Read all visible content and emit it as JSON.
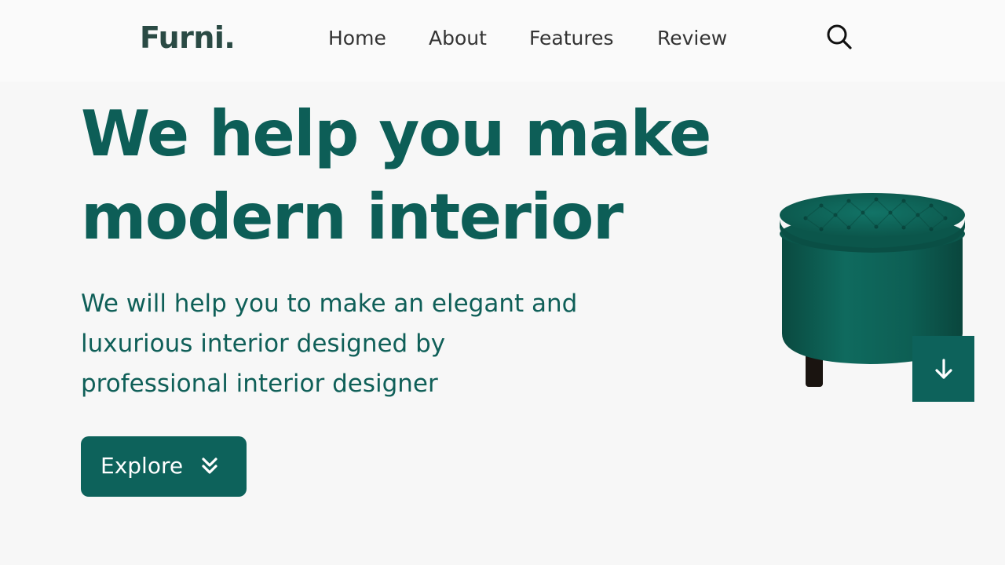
{
  "brand": {
    "logo": "Furni."
  },
  "nav": {
    "items": [
      {
        "label": "Home"
      },
      {
        "label": "About"
      },
      {
        "label": "Features"
      },
      {
        "label": "Review"
      }
    ],
    "search_icon": "search-icon"
  },
  "hero": {
    "title_line1": "We help you make",
    "title_line2": "modern interior",
    "subtitle_line1": "We will help you to make an elegant and",
    "subtitle_line2": "luxurious interior designed by",
    "subtitle_line3": "professional interior designer",
    "explore_label": "Explore",
    "explore_icon": "chevrons-down-icon",
    "scroll_icon": "arrow-down-icon",
    "product_image": "green-tufted-ottoman"
  },
  "colors": {
    "brand": "#0d5e57",
    "button": "#0d625b",
    "background": "#f7f7f7",
    "header_bg": "#fafafa"
  }
}
